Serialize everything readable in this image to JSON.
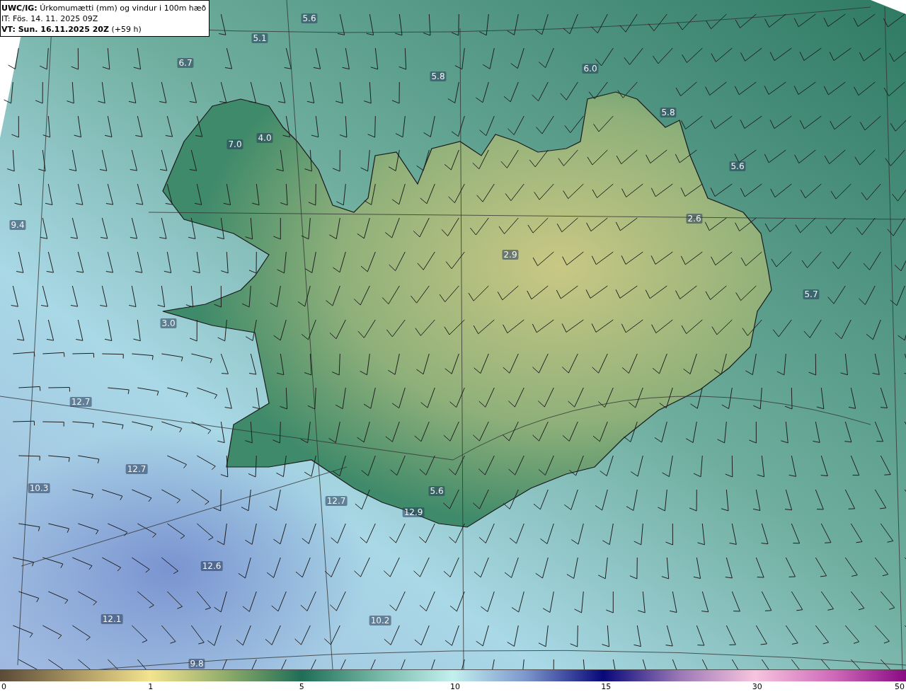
{
  "header": {
    "title": "**UWC/IG:** Úrkomumætti (mm) og vindur i 100m hæð",
    "issue_time": "IT: Fös. 14. 11. 2025 09Z",
    "valid_time": "**VT: Sun. 16.11.2025 20Z** (+59 h)"
  },
  "map_labels": [
    "5.6",
    "5.1",
    "6.7",
    "6.0",
    "5.8",
    "5.8",
    "4.0",
    "7.0",
    "5.6",
    "2.6",
    "9.4",
    "2.9",
    "5.7",
    "3.0",
    "12.7",
    "12.7",
    "10.3",
    "12.7",
    "5.6",
    "12.9",
    "12.6",
    "12.1",
    "10.2",
    "9.8"
  ],
  "colorbar": {
    "ticks": [
      "0",
      "1",
      "5",
      "10",
      "15",
      "30",
      "50"
    ]
  }
}
